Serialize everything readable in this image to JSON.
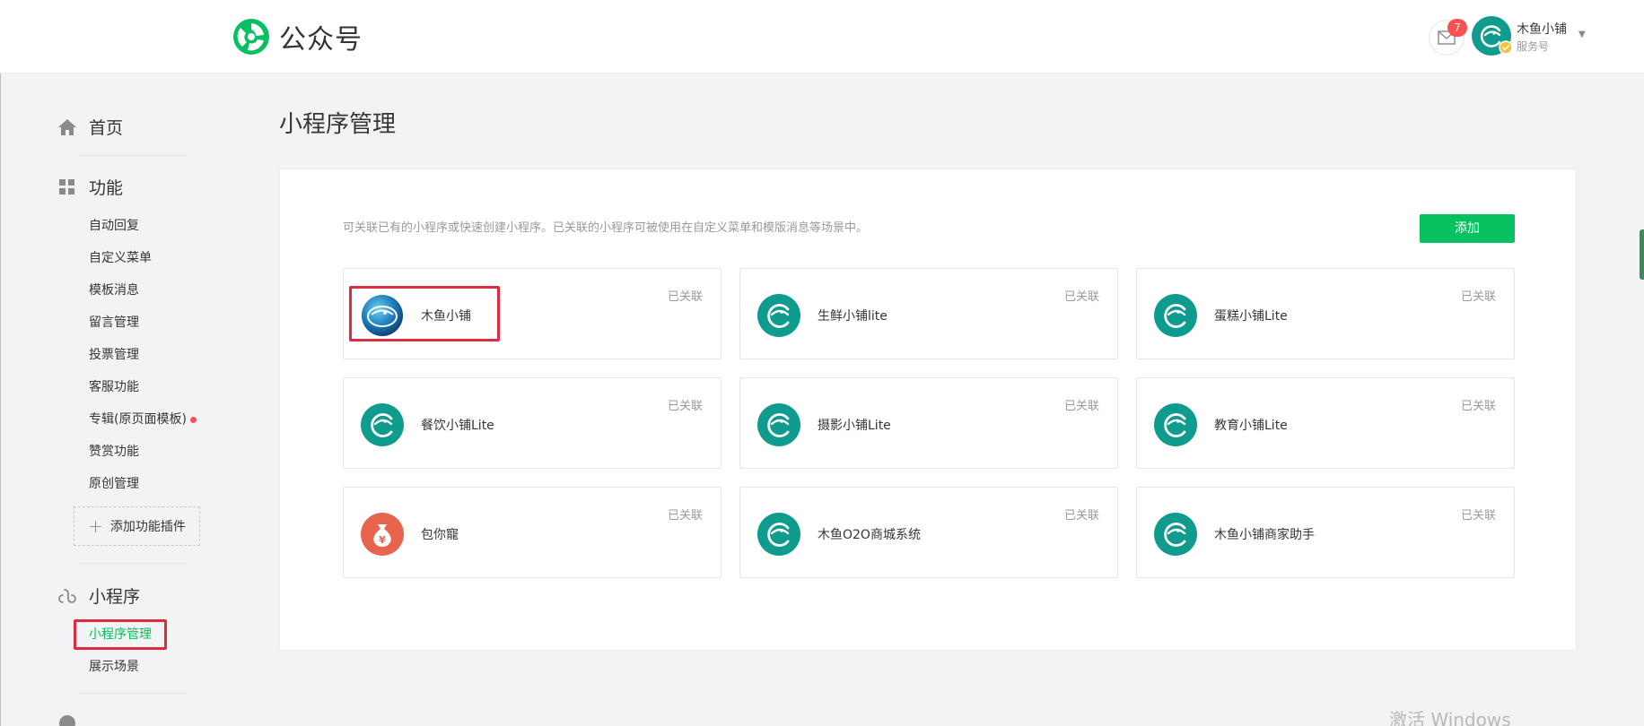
{
  "header": {
    "logo_text": "公众号",
    "message_count": "7",
    "account_name": "木鱼小铺",
    "account_type": "服务号"
  },
  "sidebar": {
    "home": "首页",
    "features": "功能",
    "feature_items": [
      "自动回复",
      "自定义菜单",
      "模板消息",
      "留言管理",
      "投票管理",
      "客服功能",
      "专辑(原页面模板)",
      "赞赏功能",
      "原创管理"
    ],
    "add_plugin": "添加功能插件",
    "miniprogram": "小程序",
    "miniprogram_items": [
      "小程序管理",
      "展示场景"
    ]
  },
  "main": {
    "title": "小程序管理",
    "description": "可关联已有的小程序或快速创建小程序。已关联的小程序可被使用在自定义菜单和模版消息等场景中。",
    "add_label": "添加",
    "cards": [
      {
        "name": "木鱼小铺",
        "status": "已关联"
      },
      {
        "name": "生鲜小铺lite",
        "status": "已关联"
      },
      {
        "name": "蛋糕小铺Lite",
        "status": "已关联"
      },
      {
        "name": "餐饮小铺Lite",
        "status": "已关联"
      },
      {
        "name": "摄影小铺Lite",
        "status": "已关联"
      },
      {
        "name": "教育小铺Lite",
        "status": "已关联"
      },
      {
        "name": "包你寵",
        "status": "已关联"
      },
      {
        "name": "木鱼O2O商城系统",
        "status": "已关联"
      },
      {
        "name": "木鱼小铺商家助手",
        "status": "已关联"
      }
    ]
  },
  "watermark": "激活 Windows",
  "colors": {
    "accent": "#07c160",
    "teal_icon": "#0f9b8e",
    "highlight": "#e02b3c",
    "badge": "#fa5151"
  }
}
